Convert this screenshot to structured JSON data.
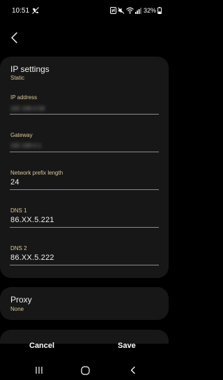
{
  "status_bar": {
    "time": "10:51",
    "battery": "32%",
    "icons": [
      "no-calls-icon",
      "nfc-icon",
      "mute-icon",
      "wifi-icon",
      "signal-icon",
      "battery-icon"
    ]
  },
  "header": {
    "back_icon": "chevron-left-icon"
  },
  "ip_settings": {
    "title": "IP settings",
    "mode": "Static",
    "fields": [
      {
        "label": "IP address",
        "value": "192.168.0.58",
        "obscured": true
      },
      {
        "label": "Gateway",
        "value": "192.168.0.1",
        "obscured": true
      },
      {
        "label": "Network prefix length",
        "value": "24",
        "obscured": false
      },
      {
        "label": "DNS 1",
        "value": "86.XX.5.221",
        "obscured": false
      },
      {
        "label": "DNS 2",
        "value": "86.XX.5.222",
        "obscured": false
      }
    ]
  },
  "proxy": {
    "title": "Proxy",
    "value": "None"
  },
  "actions": {
    "cancel": "Cancel",
    "save": "Save"
  },
  "nav_bar": {
    "icons": [
      "recents-icon",
      "home-icon",
      "back-icon"
    ]
  },
  "colors": {
    "background": "#000000",
    "card": "#171717",
    "accent_label": "#d8c79a",
    "text": "#f0f0f0"
  }
}
